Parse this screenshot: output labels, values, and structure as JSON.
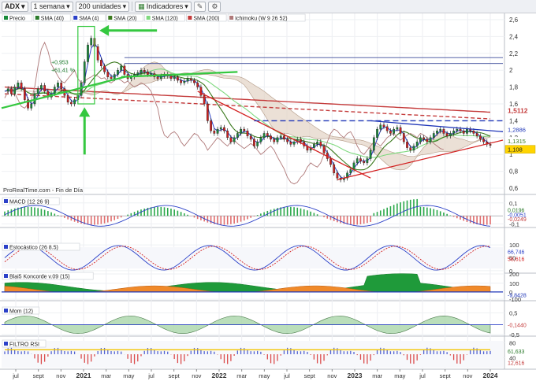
{
  "toolbar": {
    "symbol": "ADX",
    "period": "1 semana",
    "units": "200 unidades",
    "indicators": "Indicadores"
  },
  "colors": {
    "price_up": "#1a8a3a",
    "price_down": "#d11f1f",
    "sma4": "#2b40c8",
    "sma20": "#3b7a1e",
    "sma120": "#7fd97f",
    "sma200": "#c43b3b",
    "kumo_up": "#cfe9cf",
    "kumo_down": "#e2d3c4",
    "chikou": "#b07a7a",
    "arrow": "#35c840",
    "trend_red": "#d32020",
    "trend_blue": "#1f36b8"
  },
  "chart_data": [
    {
      "type": "line",
      "panel": "price",
      "legend": [
        "Precio",
        "SMA (40)",
        "SMA (4)",
        "SMA (20)",
        "SMA (120)",
        "SMA (200)",
        "Ichimoku (W 9 26 52)"
      ],
      "ylim": [
        0.6,
        2.6
      ],
      "yticks": [
        "2,6",
        "2,4",
        "2,2",
        "2",
        "1,8",
        "1,6",
        "1,4",
        "1,2",
        "1",
        "0,8",
        "0,6"
      ],
      "xticks": [
        "jul",
        "sept",
        "nov",
        "2021",
        "mar",
        "may",
        "jul",
        "sept",
        "nov",
        "2022",
        "mar",
        "may",
        "jul",
        "sept",
        "nov",
        "2023",
        "mar",
        "may",
        "jul",
        "sept",
        "nov",
        "2024"
      ],
      "annotations": [
        "+0,953",
        "+61,41 %",
        "ProRealTime.com - Fin de Día"
      ],
      "value_labels": [
        "1,5112",
        "1,2886",
        "1,1315",
        "1,108"
      ],
      "price": [
        1.75,
        1.78,
        1.72,
        1.8,
        1.85,
        1.78,
        1.65,
        1.55,
        1.6,
        1.72,
        1.78,
        1.82,
        1.75,
        1.68,
        1.72,
        1.8,
        1.85,
        1.78,
        1.7,
        1.62,
        1.6,
        1.65,
        1.7,
        1.85,
        2.1,
        2.3,
        2.38,
        2.28,
        2.12,
        2.05,
        1.98,
        1.92,
        1.9,
        1.95,
        2.0,
        2.05,
        1.95,
        1.9,
        1.92,
        1.95,
        1.97,
        2.0,
        1.98,
        1.95,
        1.96,
        1.92,
        1.9,
        1.93,
        1.95,
        1.93,
        1.9,
        1.92,
        1.88,
        1.85,
        1.87,
        1.9,
        1.88,
        1.85,
        1.8,
        1.7,
        1.6,
        1.4,
        1.28,
        1.25,
        1.3,
        1.32,
        1.28,
        1.2,
        1.15,
        1.2,
        1.25,
        1.3,
        1.28,
        1.22,
        1.18,
        1.1,
        1.15,
        1.2,
        1.25,
        1.22,
        1.18,
        1.15,
        1.2,
        1.22,
        1.18,
        1.15,
        1.12,
        1.15,
        1.18,
        1.15,
        1.1,
        1.05,
        1.08,
        1.12,
        1.15,
        1.1,
        1.02,
        0.95,
        0.88,
        0.78,
        0.72,
        0.7,
        0.72,
        0.78,
        0.82,
        0.9,
        0.95,
        0.92,
        0.9,
        0.95,
        1.05,
        1.2,
        1.3,
        1.35,
        1.33,
        1.28,
        1.25,
        1.3,
        1.32,
        1.25,
        1.15,
        1.08,
        1.05,
        1.1,
        1.15,
        1.2,
        1.18,
        1.15,
        1.2,
        1.25,
        1.28,
        1.3,
        1.25,
        1.22,
        1.25,
        1.28,
        1.3,
        1.28,
        1.25,
        1.3,
        1.28,
        1.25,
        1.22,
        1.18,
        1.15,
        1.12,
        1.108
      ]
    },
    {
      "type": "bar",
      "panel": "macd",
      "legend": "MACD (12 26 9)",
      "yticks": [
        "0,1",
        "-0,1"
      ],
      "value_labels": [
        "0,0196",
        "-0,0051",
        "-0,0249"
      ]
    },
    {
      "type": "line",
      "panel": "stochastic",
      "legend": "Estocástico (26 8.5)",
      "yticks": [
        "100",
        "50",
        "0"
      ],
      "value_labels": [
        "66,746",
        "58,616"
      ]
    },
    {
      "type": "area",
      "panel": "koncorde",
      "legend": "Blai5 Koncorde v.09 (15)",
      "yticks": [
        "200",
        "100",
        "0",
        "-100"
      ],
      "value_labels": [
        "-9,8428"
      ]
    },
    {
      "type": "line",
      "panel": "momentum",
      "legend": "Mom (12)",
      "yticks": [
        "0,5",
        "-0,5"
      ],
      "value_labels": [
        "-0,1440"
      ]
    },
    {
      "type": "area",
      "panel": "rsi",
      "legend": "FILTRO RSI",
      "yticks": [
        "80",
        "40"
      ],
      "value_labels": [
        "61,633",
        "12,616"
      ]
    }
  ]
}
